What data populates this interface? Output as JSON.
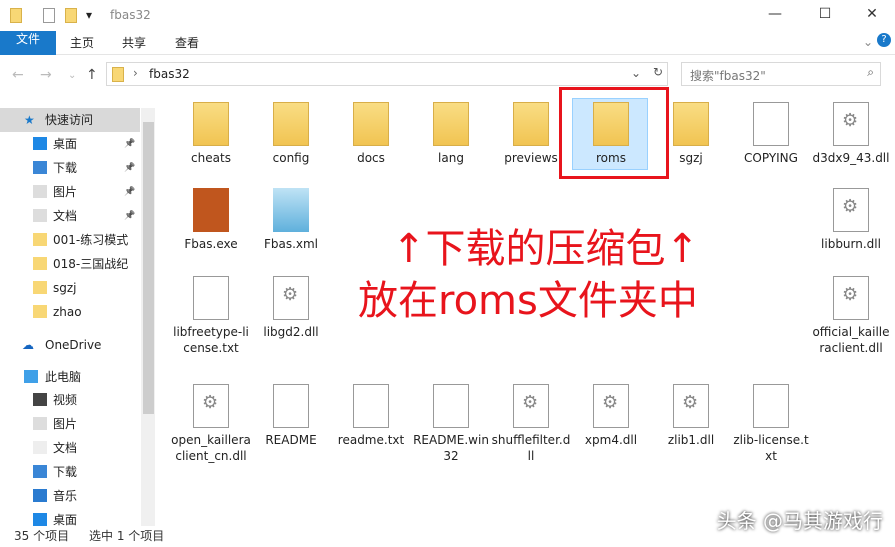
{
  "window": {
    "title": "fbas32",
    "minimize": "—",
    "maximize": "☐",
    "close": "✕"
  },
  "ribbon": {
    "tabs": [
      "文件",
      "主页",
      "共享",
      "查看"
    ]
  },
  "address": {
    "path": "fbas32",
    "search_placeholder": "搜索\"fbas32\""
  },
  "sidebar": {
    "quick_access": "快速访问",
    "items": [
      {
        "label": "桌面",
        "icon": "desktop-icon",
        "pinned": true
      },
      {
        "label": "下载",
        "icon": "download-icon",
        "pinned": true
      },
      {
        "label": "图片",
        "icon": "pictures-icon",
        "pinned": true
      },
      {
        "label": "文档",
        "icon": "documents-icon",
        "pinned": true
      },
      {
        "label": "001-练习模式",
        "icon": "folder-icon"
      },
      {
        "label": "018-三国战纪",
        "icon": "folder-icon"
      },
      {
        "label": "sgzj",
        "icon": "folder-icon"
      },
      {
        "label": "zhao",
        "icon": "folder-icon"
      }
    ],
    "onedrive": "OneDrive",
    "this_pc": "此电脑",
    "pc_items": [
      {
        "label": "视频"
      },
      {
        "label": "图片"
      },
      {
        "label": "文档"
      },
      {
        "label": "下载"
      },
      {
        "label": "音乐"
      },
      {
        "label": "桌面"
      }
    ]
  },
  "files": [
    {
      "name": "cheats",
      "type": "folder"
    },
    {
      "name": "config",
      "type": "folder"
    },
    {
      "name": "docs",
      "type": "folder"
    },
    {
      "name": "lang",
      "type": "folder"
    },
    {
      "name": "previews",
      "type": "folder"
    },
    {
      "name": "roms",
      "type": "folder",
      "selected": true
    },
    {
      "name": "sgzj",
      "type": "folder"
    },
    {
      "name": "COPYING",
      "type": "doc"
    },
    {
      "name": "d3dx9_43.dll",
      "type": "dll"
    },
    {
      "name": "Fbas.exe",
      "type": "exe"
    },
    {
      "name": "Fbas.xml",
      "type": "xml"
    },
    {
      "name": "libburn.dll",
      "type": "dll"
    },
    {
      "name": "libfreetype-license.txt",
      "type": "doc"
    },
    {
      "name": "libgd2.dll",
      "type": "dll"
    },
    {
      "name": "official_kailleraclient.dll",
      "type": "dll"
    },
    {
      "name": "open_kailleraclient_cn.dll",
      "type": "dll"
    },
    {
      "name": "README",
      "type": "doc"
    },
    {
      "name": "readme.txt",
      "type": "doc"
    },
    {
      "name": "README.win32",
      "type": "doc"
    },
    {
      "name": "shufflefilter.dll",
      "type": "dll"
    },
    {
      "name": "xpm4.dll",
      "type": "dll"
    },
    {
      "name": "zlib1.dll",
      "type": "dll"
    },
    {
      "name": "zlib-license.txt",
      "type": "doc"
    }
  ],
  "annotation": {
    "line1": "↑下载的压缩包↑",
    "line2": "放在roms文件夹中",
    "color": "#e8141c"
  },
  "status": {
    "count": "35 个项目",
    "selected": "选中 1 个项目"
  },
  "watermark": "头条 @马其游戏行"
}
